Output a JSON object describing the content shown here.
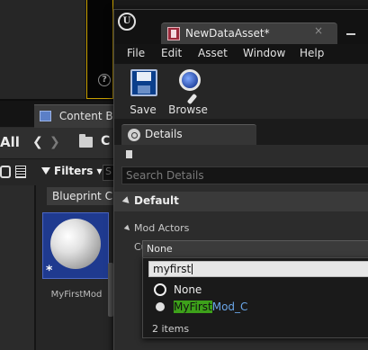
{
  "content_browser": {
    "tab_label": "Content Bro",
    "all_label": "All",
    "path_label": "C",
    "filters_label": "Filters",
    "search_placeholder": "S",
    "path_chip": "Blueprint Cla",
    "asset_name": "MyFirstMod",
    "asset_badge": "*"
  },
  "viewport": {
    "help_label": "?"
  },
  "editor_window": {
    "logo_label": "U",
    "tab_title": "NewDataAsset*",
    "tab_close": "×",
    "menu": [
      "File",
      "Edit",
      "Asset",
      "Window",
      "Help"
    ],
    "toolbar": {
      "save_label": "Save",
      "browse_label": "Browse"
    },
    "details": {
      "tab_label": "Details",
      "search_placeholder": "Search Details",
      "category": "Default",
      "property_label": "Mod Actors",
      "combo_value": "None",
      "sub_label": "Cu"
    },
    "picker": {
      "search_value": "myfirst",
      "options": [
        {
          "label": "None",
          "selected": true
        },
        {
          "label_match": "MyFirst",
          "label_rest": "Mod_C",
          "selected": false
        }
      ],
      "count_label": "2 items",
      "highlight_color": "#3da11a",
      "link_color": "#6aa6e8"
    }
  }
}
